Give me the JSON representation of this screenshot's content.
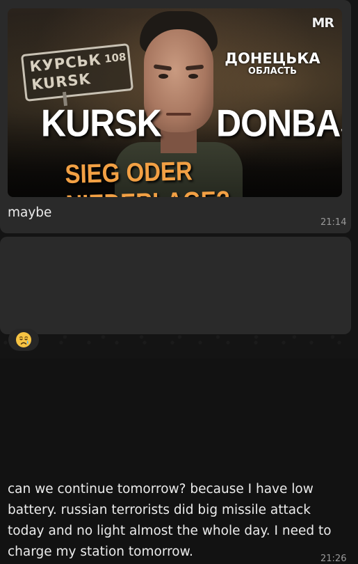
{
  "messages": [
    {
      "thumbnail": {
        "sign_line1": "КУРСЬК",
        "sign_number": "108",
        "sign_line2": "KURSK",
        "logo": "MR",
        "oblast_line1": "ДОНЕЦЬКА",
        "oblast_line2": "ОБЛАСТЬ",
        "left_title": "KURSK",
        "right_title": "DONBAS",
        "headline": "SIEG ODER NIEDERLAGE?"
      },
      "text": "maybe",
      "time": "21:14"
    },
    {
      "text": "can we continue tomorrow? because I have low battery. russian terrorists did big missile attack today and no light almost the whole day. I need to charge my station tomorrow.",
      "time": "21:26",
      "reaction": {
        "icon": "crying-face-icon"
      }
    }
  ],
  "colors": {
    "bubble": "#2a2a2a",
    "background": "#141414",
    "text": "#ececec",
    "time": "#9a9a9a",
    "headline": "#f2a044"
  }
}
